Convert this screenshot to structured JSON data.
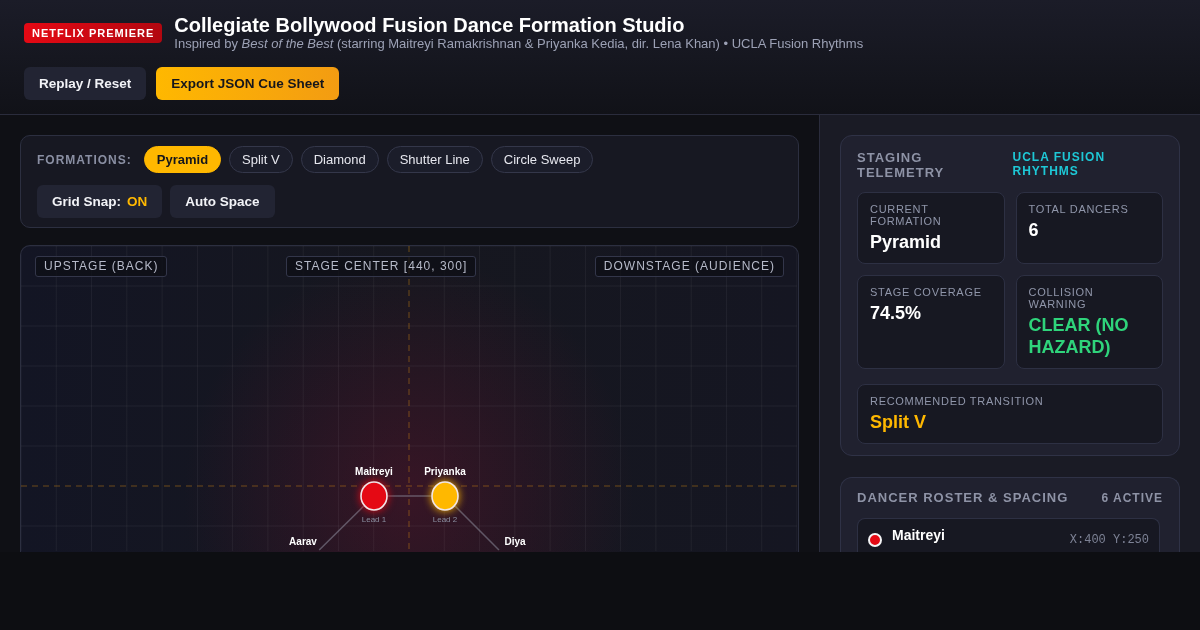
{
  "header": {
    "badge": "NETFLIX PREMIERE",
    "title": "Collegiate Bollywood Fusion Dance Formation Studio",
    "subtitle": "Inspired by *Best of the Best* (starring Maitreyi Ramakrishnan & Priyanka Kedia, dir. Lena Khan) • UCLA Fusion Rhythms",
    "buttons": [
      {
        "label": "Replay / Reset",
        "kind": "secondary"
      },
      {
        "label": "Export JSON Cue Sheet",
        "kind": "primary"
      }
    ]
  },
  "formations": {
    "label": "FORMATIONS:",
    "options": [
      {
        "label": "Pyramid",
        "selected": true
      },
      {
        "label": "Split V",
        "selected": false
      },
      {
        "label": "Diamond",
        "selected": false
      },
      {
        "label": "Shutter Line",
        "selected": false
      },
      {
        "label": "Circle Sweep",
        "selected": false
      }
    ],
    "grid_snap": {
      "label": "Grid Snap:",
      "value": "ON",
      "on": true
    },
    "auto_space": "Auto Space"
  },
  "stage": {
    "labels": [
      "UPSTAGE (BACK)",
      "STAGE CENTER [440, 300]",
      "DOWNSTAGE (AUDIENCE)"
    ],
    "dancers": [
      {
        "name": "Maitreyi",
        "role": "Lead 1",
        "color": "#e50914"
      },
      {
        "name": "Priyanka",
        "role": "Lead 2",
        "color": "#ffb800"
      },
      {
        "name": "Aarav"
      },
      {
        "name": "Diya"
      }
    ]
  },
  "telemetry": {
    "title": "STAGING TELEMETRY",
    "team": "UCLA FUSION RHYTHMS",
    "stats": [
      {
        "label": "CURRENT FORMATION",
        "value": "Pyramid",
        "kind": "metric"
      },
      {
        "label": "TOTAL DANCERS",
        "value": "6",
        "kind": "metric"
      },
      {
        "label": "STAGE COVERAGE",
        "value": "74.5%",
        "kind": "metric"
      },
      {
        "label": "COLLISION WARNING",
        "value": "CLEAR (NO HAZARD)",
        "kind": "status"
      }
    ],
    "recommendation": {
      "label": "RECOMMENDED TRANSITION",
      "value": "Split V"
    }
  },
  "roster": {
    "title": "DANCER ROSTER & SPACING",
    "count": "6 ACTIVE",
    "dancers": [
      {
        "name": "Maitreyi",
        "color": "#e50914",
        "position": "X:400 Y:250"
      }
    ]
  }
}
